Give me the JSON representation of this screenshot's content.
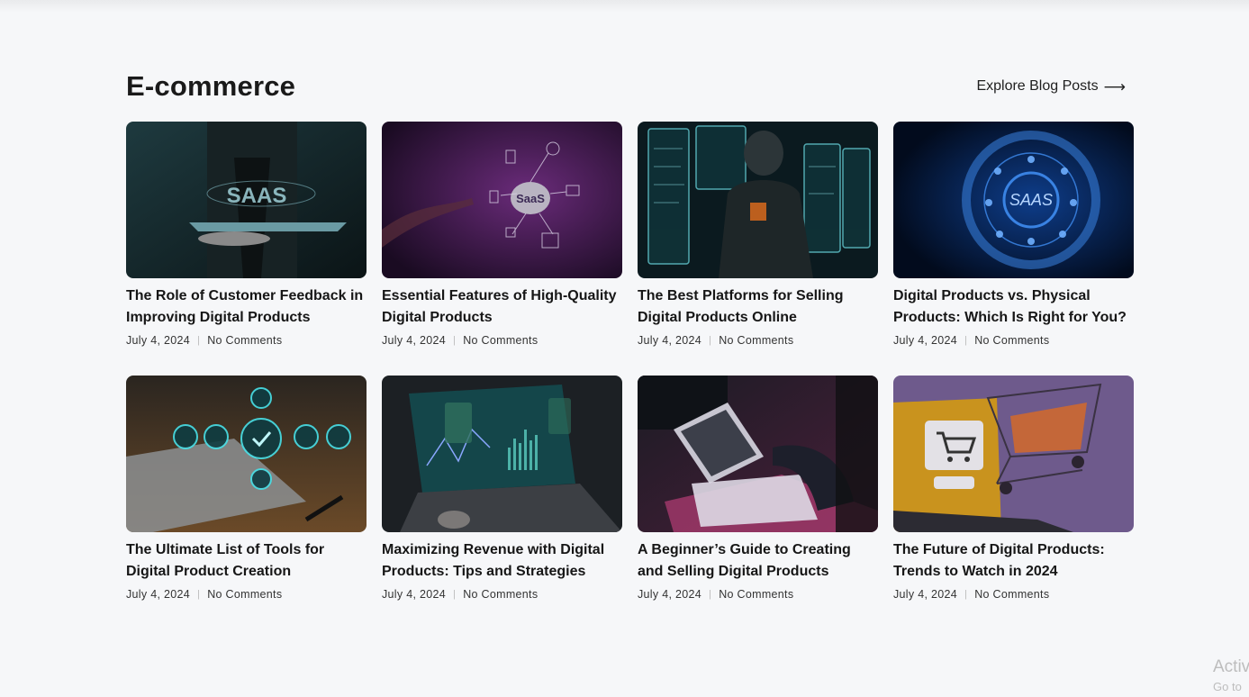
{
  "section": {
    "title": "E-commerce",
    "explore_label": "Explore Blog Posts",
    "explore_icon": "arrow-right-icon"
  },
  "posts": [
    {
      "title": "The Role of Customer Feedback in Improving Digital Products",
      "date": "July 4, 2024",
      "comments": "No Comments",
      "thumb_text": "SAAS"
    },
    {
      "title": "Essential Features of High-Quality Digital Products",
      "date": "July 4, 2024",
      "comments": "No Comments",
      "thumb_text": "SaaS"
    },
    {
      "title": "The Best Platforms for Selling Digital Products Online",
      "date": "July 4, 2024",
      "comments": "No Comments",
      "thumb_text": ""
    },
    {
      "title": "Digital Products vs. Physical Products: Which Is Right for You?",
      "date": "July 4, 2024",
      "comments": "No Comments",
      "thumb_text": "SAAS"
    },
    {
      "title": "The Ultimate List of Tools for Digital Product Creation",
      "date": "July 4, 2024",
      "comments": "No Comments",
      "thumb_text": ""
    },
    {
      "title": "Maximizing Revenue with Digital Products: Tips and Strategies",
      "date": "July 4, 2024",
      "comments": "No Comments",
      "thumb_text": ""
    },
    {
      "title": "A Beginner’s Guide to Creating and Selling Digital Products",
      "date": "July 4, 2024",
      "comments": "No Comments",
      "thumb_text": ""
    },
    {
      "title": "The Future of Digital Products: Trends to Watch in 2024",
      "date": "July 4, 2024",
      "comments": "No Comments",
      "thumb_text": ""
    }
  ],
  "watermark": {
    "line1": "Activ",
    "line2": "Go to"
  }
}
